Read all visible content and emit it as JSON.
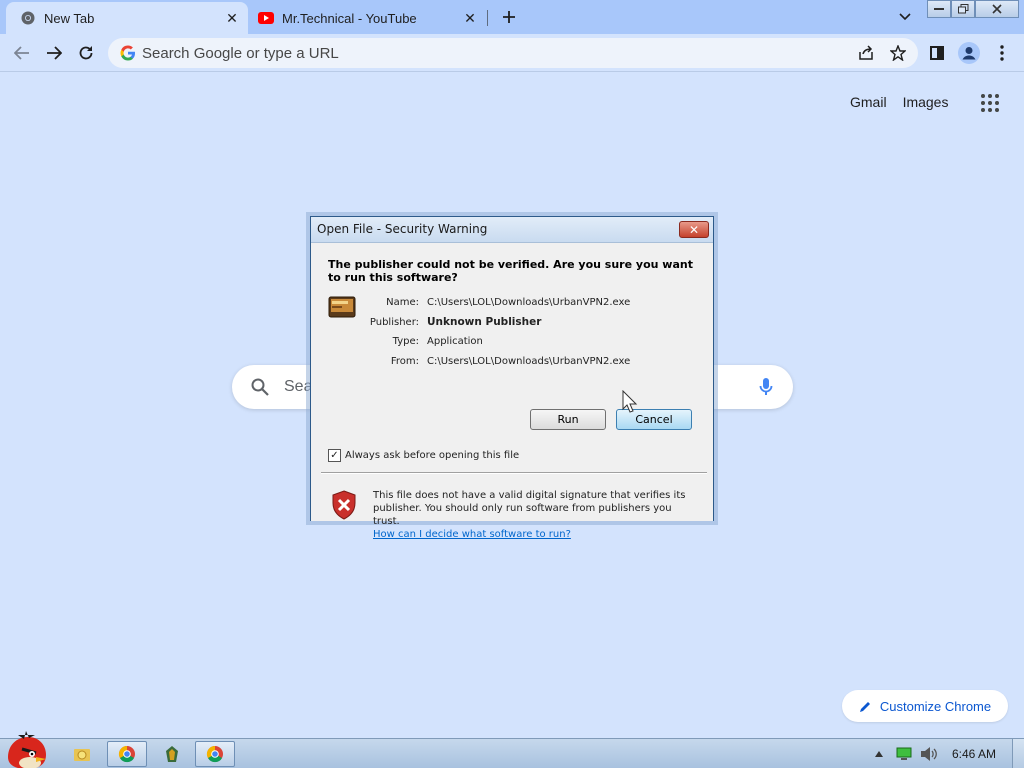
{
  "tabs": [
    {
      "title": "New Tab",
      "icon": "chrome-icon",
      "active": true
    },
    {
      "title": "Mr.Technical - YouTube",
      "icon": "youtube-icon",
      "active": false
    }
  ],
  "omnibox": {
    "placeholder": "Search Google or type a URL"
  },
  "page": {
    "links": {
      "gmail": "Gmail",
      "images": "Images"
    },
    "search_partial": "Sea",
    "customize_label": "Customize Chrome"
  },
  "dialog": {
    "title": "Open File - Security Warning",
    "heading": "The publisher could not be verified.  Are you sure you want to run this software?",
    "fields": [
      {
        "label": "Name:",
        "value": "C:\\Users\\LOL\\Downloads\\UrbanVPN2.exe"
      },
      {
        "label": "Publisher:",
        "value": "Unknown Publisher"
      },
      {
        "label": "Type:",
        "value": "Application"
      },
      {
        "label": "From:",
        "value": "C:\\Users\\LOL\\Downloads\\UrbanVPN2.exe"
      }
    ],
    "run_label": "Run",
    "cancel_label": "Cancel",
    "checkbox_label": "Always ask before opening this file",
    "checkbox_checked": true,
    "warning_text": "This file does not have a valid digital signature that verifies its publisher.  You should only run software from publishers you trust.",
    "warning_link": "How can I decide what software to run?"
  },
  "taskbar": {
    "clock": "6:46 AM"
  },
  "colors": {
    "accent": "#0b57d0",
    "page_bg": "#d3e3fd",
    "tabstrip": "#a8c7fa"
  }
}
